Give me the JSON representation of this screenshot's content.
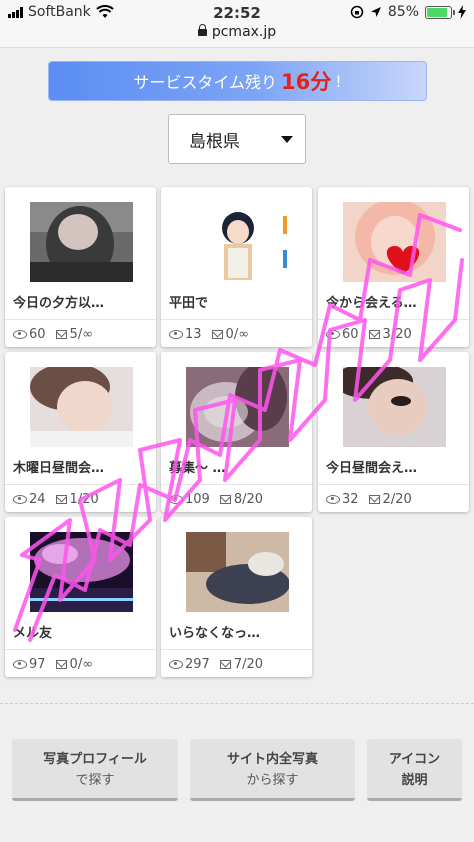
{
  "status_bar": {
    "carrier": "SoftBank",
    "time": "22:52",
    "battery_percent": "85%",
    "battery_level": 0.85,
    "url": "pcmax.jp"
  },
  "banner": {
    "prefix": "サービスタイム残り",
    "minutes": "16分",
    "suffix": "!"
  },
  "prefecture_select": {
    "value": "島根県"
  },
  "cards": [
    {
      "title": "今日の夕方以…",
      "views": "60",
      "messages": "5/∞"
    },
    {
      "title": "平田で",
      "views": "13",
      "messages": "0/∞"
    },
    {
      "title": "今から会える…",
      "views": "60",
      "messages": "3/20"
    },
    {
      "title": "木曜日昼間会…",
      "views": "24",
      "messages": "1/20"
    },
    {
      "title": "募集〜 …",
      "views": "109",
      "messages": "8/20"
    },
    {
      "title": "今日昼間会え…",
      "views": "32",
      "messages": "2/20"
    },
    {
      "title": "メル友",
      "views": "97",
      "messages": "0/∞"
    },
    {
      "title": "いらなくなっ…",
      "views": "297",
      "messages": "7/20"
    }
  ],
  "buttons": {
    "photo_profile": {
      "line1": "写真プロフィール",
      "line2": "で探す"
    },
    "site_photos": {
      "line1": "サイト内全写真",
      "line2": "から探す"
    },
    "icon_help": {
      "line1": "アイコン",
      "line2": "説明"
    }
  },
  "colors": {
    "accent_red": "#e2231a",
    "banner_blue": "#5b8df3",
    "battery_green": "#4cd964"
  }
}
